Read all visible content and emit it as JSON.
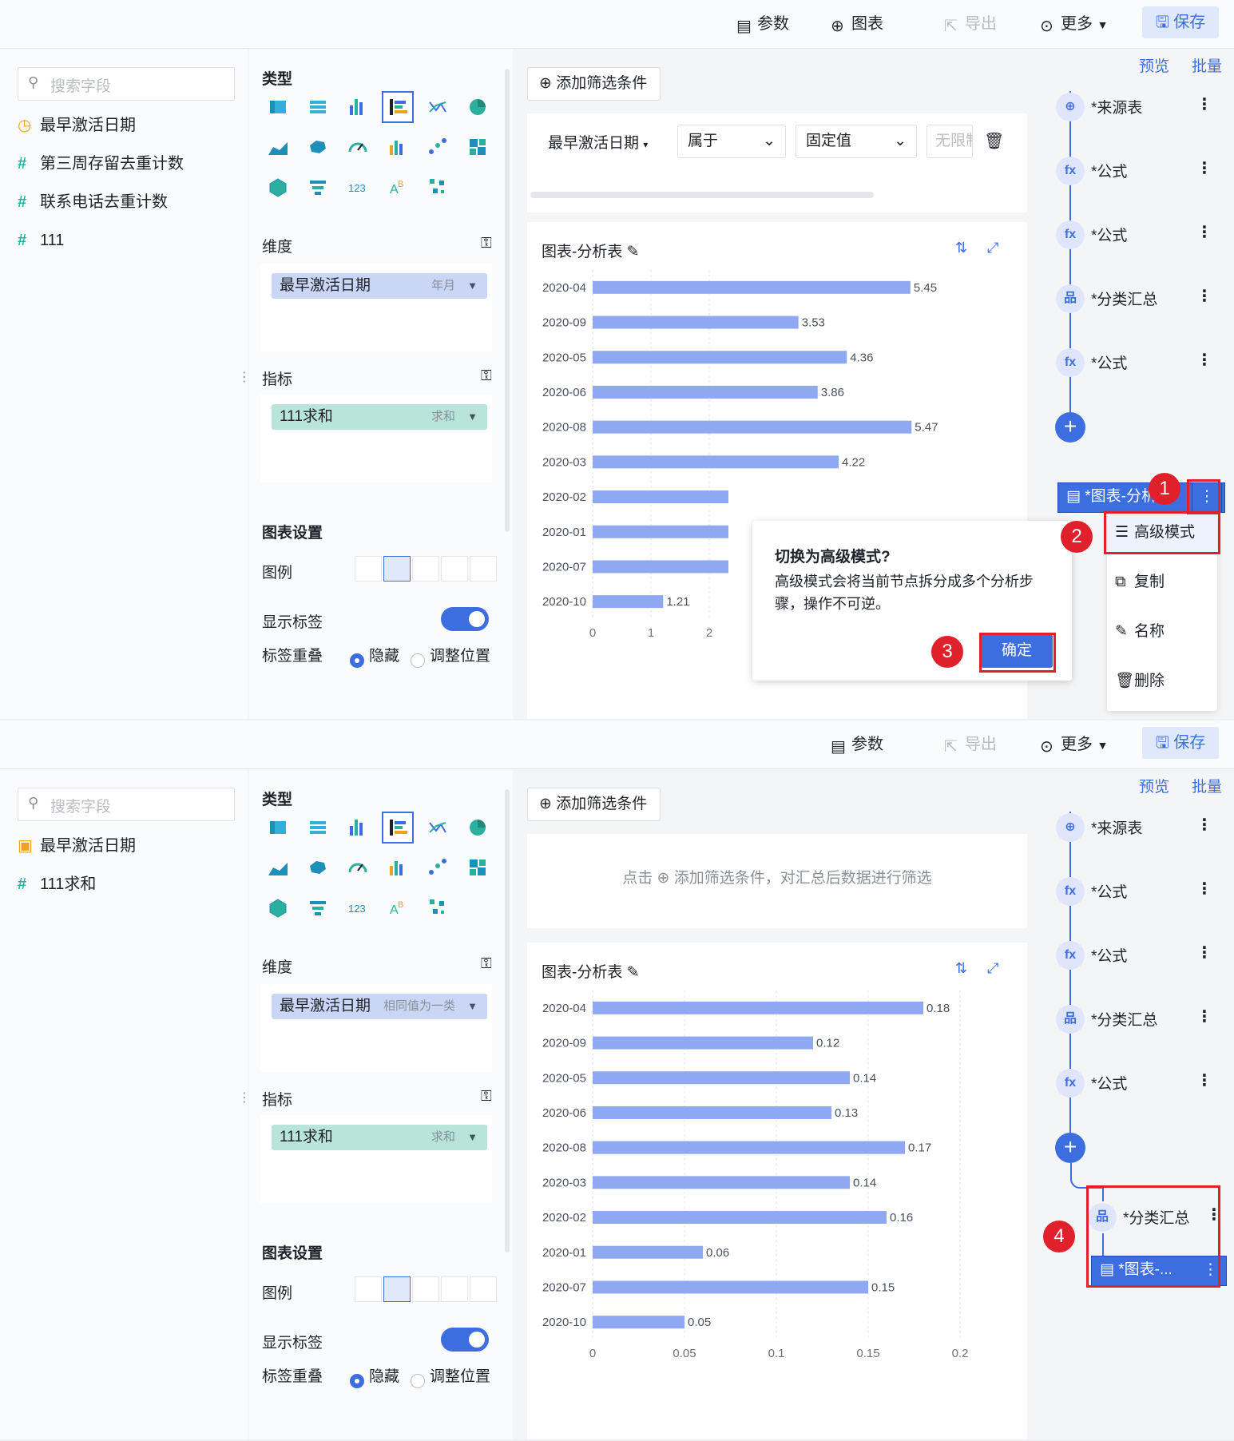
{
  "toolbar_top": {
    "params": "参数",
    "chart": "图表",
    "export": "导出",
    "more": "更多",
    "save": "保存"
  },
  "toolbar_bottom": {
    "params": "参数",
    "export": "导出",
    "more": "更多",
    "save": "保存"
  },
  "search_placeholder": "搜索字段",
  "fields_top": [
    "最早激活日期",
    "第三周存留去重计数",
    "联系电话去重计数",
    "111"
  ],
  "fields_bottom": [
    "最早激活日期",
    "111求和"
  ],
  "cfg": {
    "type": "类型",
    "dimension": "维度",
    "metric": "指标",
    "chart_settings": "图表设置",
    "legend": "图例",
    "show_label": "显示标签",
    "label_overlap": "标签重叠",
    "hide": "隐藏",
    "adjust": "调整位置",
    "dim_top": {
      "name": "最早激活日期",
      "mod": "年月"
    },
    "dim_bottom": {
      "name": "最早激活日期",
      "mod": "相同值为一类"
    },
    "metric_pill": {
      "name": "111求和",
      "mod": "求和"
    }
  },
  "add_filter": "添加筛选条件",
  "filter_row": {
    "field": "最早激活日期",
    "op": "属于",
    "mode": "固定值",
    "value": "无限制"
  },
  "filter_hint": "点击 ⊕ 添加筛选条件，对汇总后数据进行筛选",
  "chart_title": "图表-分析表",
  "flow": {
    "preview": "预览",
    "batch": "批量",
    "source": "*来源表",
    "formula": "*公式",
    "group": "*分类汇总",
    "chart_node_top": "*图表-分析...",
    "chart_node_bottom": "*图表-...",
    "group_new": "*分类汇总"
  },
  "context_menu": [
    "高级模式",
    "复制",
    "名称",
    "删除"
  ],
  "popup": {
    "title": "切换为高级模式?",
    "body": "高级模式会将当前节点拆分成多个分析步骤，操作不可逆。",
    "confirm": "确定"
  },
  "badges": [
    "1",
    "2",
    "3",
    "4"
  ],
  "chart_data": [
    {
      "type": "bar",
      "orientation": "horizontal",
      "categories": [
        "2020-04",
        "2020-09",
        "2020-05",
        "2020-06",
        "2020-08",
        "2020-03",
        "2020-02",
        "2020-01",
        "2020-07",
        "2020-10"
      ],
      "values": [
        5.45,
        3.53,
        4.36,
        3.86,
        5.47,
        4.22,
        null,
        null,
        null,
        1.21
      ],
      "xticks": [
        "0",
        "1",
        "2"
      ],
      "xlim": [
        0,
        6
      ]
    },
    {
      "type": "bar",
      "orientation": "horizontal",
      "categories": [
        "2020-04",
        "2020-09",
        "2020-05",
        "2020-06",
        "2020-08",
        "2020-03",
        "2020-02",
        "2020-01",
        "2020-07",
        "2020-10"
      ],
      "values": [
        0.18,
        0.12,
        0.14,
        0.13,
        0.17,
        0.14,
        0.16,
        0.06,
        0.15,
        0.05
      ],
      "xticks": [
        "0",
        "0.05",
        "0.1",
        "0.15",
        "0.2"
      ],
      "xlim": [
        0,
        0.2
      ]
    }
  ],
  "colors": {
    "accent": "#3d6ee0",
    "bar": "#8ea9f2",
    "danger": "#e0202a"
  }
}
